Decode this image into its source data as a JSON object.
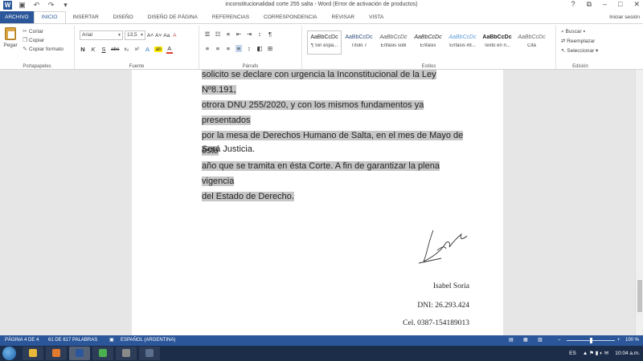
{
  "titlebar": {
    "title": "inconstitucionalidad corte 255 salta - Word (Error de activación de productos)",
    "help": "?",
    "restore": "⧉",
    "minimize": "–",
    "maximize": "□",
    "close": "✕"
  },
  "tabs": [
    "ARCHIVO",
    "INICIO",
    "INSERTAR",
    "DISEÑO",
    "DISEÑO DE PÁGINA",
    "REFERENCIAS",
    "CORRESPONDENCIA",
    "REVISAR",
    "VISTA"
  ],
  "signin": "Iniciar sesión",
  "clipboard": {
    "paste": "Pegar",
    "cut": "Cortar",
    "copy": "Copiar",
    "format_painter": "Copiar formato",
    "label": "Portapapeles"
  },
  "font": {
    "name": "Arial",
    "size": "13,5",
    "grow": "A˄",
    "shrink": "A˅",
    "case": "Aa",
    "clear": "A",
    "bold": "N",
    "italic": "K",
    "underline": "S",
    "strike": "abc",
    "subscript": "x₂",
    "superscript": "x²",
    "effects": "A",
    "highlight": "ab",
    "color": "A",
    "label": "Fuente"
  },
  "paragraph": {
    "label": "Párrafo",
    "row1": [
      "☰",
      "☷",
      "≡",
      "⇤",
      "⇥",
      "↕",
      "¶"
    ],
    "row2": [
      "≡",
      "≡",
      "≡",
      "≡",
      "↕",
      "◧",
      "⊞"
    ]
  },
  "styles": {
    "label": "Estilos",
    "items": [
      {
        "sample": "AaBbCcDc",
        "name": "¶ Sin espa..."
      },
      {
        "sample": "AaBbCcDc",
        "name": "Título 7"
      },
      {
        "sample": "AaBbCcDc",
        "name": "Énfasis sutil"
      },
      {
        "sample": "AaBbCcDc",
        "name": "Énfasis"
      },
      {
        "sample": "AaBbCcDc",
        "name": "Énfasis int..."
      },
      {
        "sample": "AaBbCcDc",
        "name": "Texto en n..."
      },
      {
        "sample": "AaBbCcDc",
        "name": "Cita"
      }
    ]
  },
  "editing": {
    "label": "Edición",
    "find": "Buscar",
    "replace": "Reemplazar",
    "select": "Seleccionar"
  },
  "document": {
    "lines": [
      "solicito se declare con urgencia  la Inconstitucional de la Ley Nº8.191,",
      "otrora DNU 255/2020, y con los mismos fundamentos ya presentados",
      "por la mesa de Derechos Humano de Salta, en el mes de Mayo de éste",
      "año que se tramita en ésta Corte. A fin de garantizar la plena vigencia",
      "del Estado de Derecho."
    ],
    "closing": "Será Justicia.",
    "name": "Isabel Soria",
    "dni": "DNI: 26.293.424",
    "phone": "Cel. 0387-154189013"
  },
  "status": {
    "page": "PÁGINA 4 DE 4",
    "words": "61 DE 617 PALABRAS",
    "language": "ESPAÑOL (ARGENTINA)",
    "zoom": "100 %",
    "zoom_level": 0.5
  },
  "taskbar": {
    "lang": "ES",
    "time": "10:04 a.m.",
    "apps": [
      {
        "name": "explorer",
        "color": "#e8b83a"
      },
      {
        "name": "media",
        "color": "#e27a2f"
      },
      {
        "name": "word",
        "color": "#2b579a"
      },
      {
        "name": "chrome",
        "color": "#4caf50"
      },
      {
        "name": "app5",
        "color": "#8a8a8a"
      },
      {
        "name": "app6",
        "color": "#5b6e8c"
      }
    ]
  }
}
